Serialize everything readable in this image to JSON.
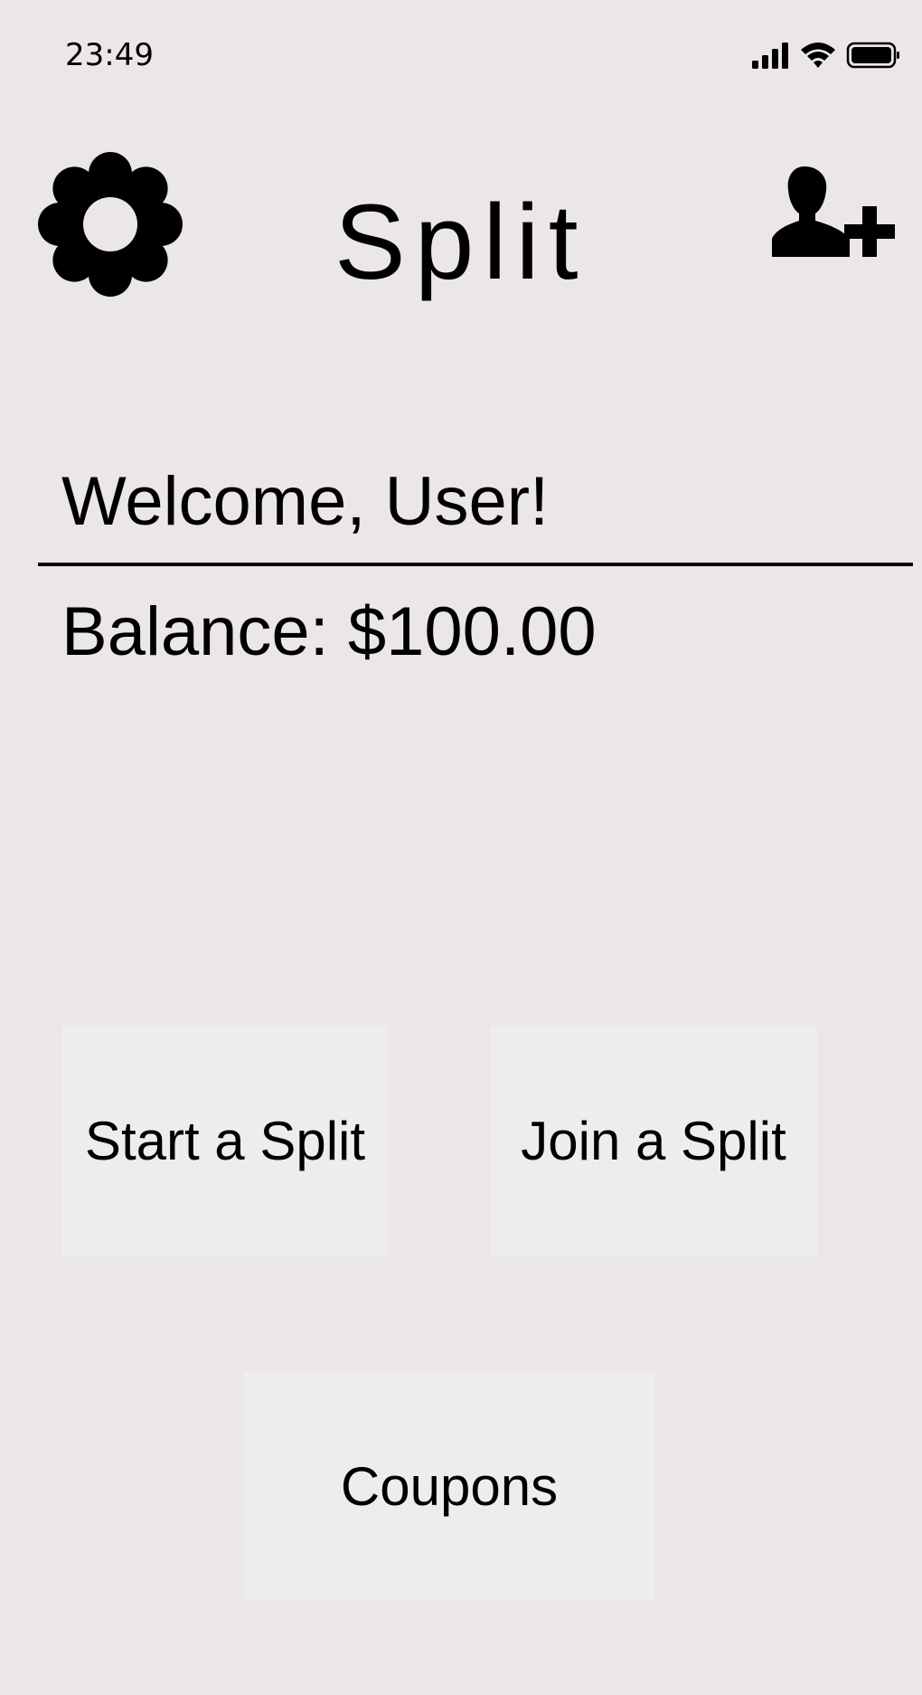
{
  "status_bar": {
    "time": "23:49",
    "signal_icon": "cellular-signal-icon",
    "wifi_icon": "wifi-icon",
    "battery_icon": "battery-icon"
  },
  "header": {
    "title": "Split",
    "settings_icon": "gear-icon",
    "add_user_icon": "add-user-icon"
  },
  "account": {
    "welcome": "Welcome, User!",
    "balance": "Balance: $100.00"
  },
  "actions": {
    "start_label": "Start a Split",
    "join_label": "Join a Split",
    "coupons_label": "Coupons"
  },
  "colors": {
    "background": "#ebe7e8",
    "tile": "#ededed",
    "text": "#000000"
  }
}
